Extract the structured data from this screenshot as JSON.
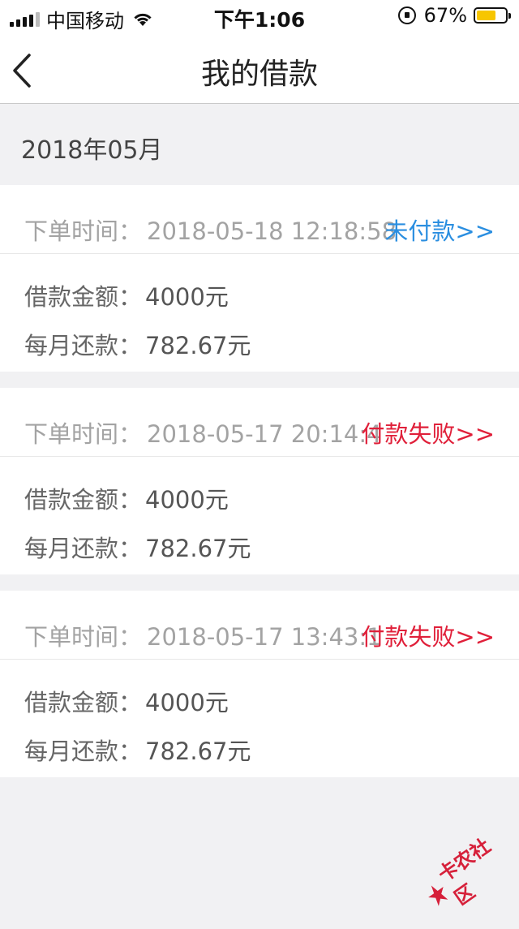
{
  "status_bar": {
    "carrier": "中国移动",
    "time": "下午1:06",
    "battery_percent": "67%",
    "battery_level": 0.67
  },
  "header": {
    "title": "我的借款"
  },
  "month": "2018年05月",
  "orders": [
    {
      "time_label": "下单时间：",
      "time": "2018-05-18 12:18:58",
      "status": "未付款>>",
      "amount_label": "借款金额：",
      "amount": "4000元",
      "monthly_label": "每月还款：",
      "monthly": "782.67元"
    },
    {
      "time_label": "下单时间：",
      "time": "2018-05-17 20:14:4",
      "status": "付款失败>>",
      "amount_label": "借款金额：",
      "amount": "4000元",
      "monthly_label": "每月还款：",
      "monthly": "782.67元"
    },
    {
      "time_label": "下单时间：",
      "time": "2018-05-17 13:43:1",
      "status": "付款失败>>",
      "amount_label": "借款金额：",
      "amount": "4000元",
      "monthly_label": "每月还款：",
      "monthly": "782.67元"
    }
  ],
  "watermark": "卡农社区",
  "colors": {
    "unpaid": "#2a8ee0",
    "failed": "#e0203a",
    "battery": "#f7c600"
  }
}
